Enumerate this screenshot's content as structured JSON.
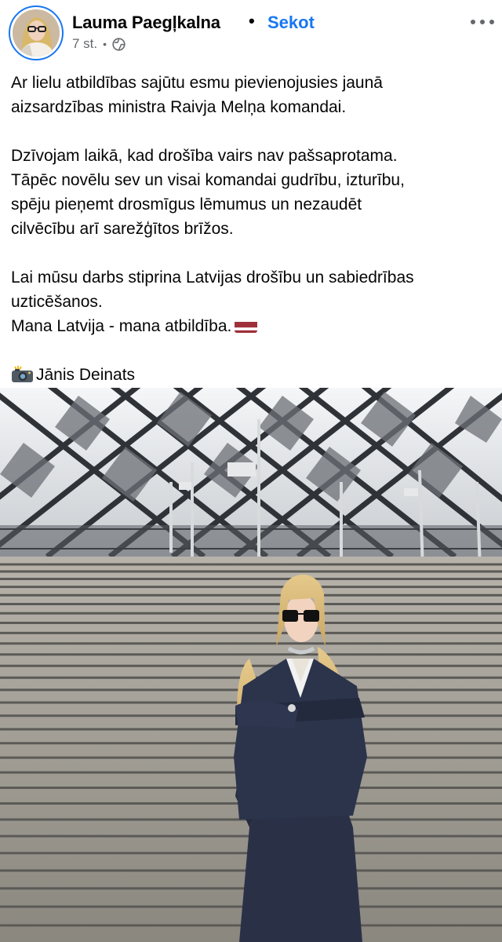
{
  "author": {
    "name": "Lauma Paegļkalna",
    "follow_label": "Sekot",
    "separator": "•",
    "time": "7 st.",
    "meta_separator": "•",
    "audience_icon": "globe-icon"
  },
  "header": {
    "more_icon": "more-options-icon"
  },
  "post": {
    "lines": [
      "Ar lielu atbildības sajūtu esmu pievienojusies jaunā",
      "aizsardzības ministra Raivja Melņa komandai.",
      "Dzīvojam laikā, kad drošība vairs nav pašsaprotama.",
      "Tāpēc novēlu sev un visai komandai gudrību, izturību,",
      "spēju pieņemt drosmīgus lēmumus un nezaudēt",
      "cilvēcību arī sarežģītos brīžos.",
      "Lai mūsu darbs stiprina Latvijas drošību un sabiedrības",
      "uzticēšanos.",
      "Mana Latvija - mana atbildība."
    ],
    "flag_icon": "latvia-flag-icon",
    "camera_icon": "camera-flash-icon",
    "photo_credit": "Jānis Deinats"
  },
  "photo": {
    "subject": "woman-in-navy-suit-on-stadium-steps",
    "colors": {
      "suit": "#2a3147",
      "steps": "#a7a39b",
      "sky": "#eef1f4"
    }
  },
  "colors": {
    "accent": "#1877f2",
    "text": "#050505",
    "muted": "#65676b"
  }
}
